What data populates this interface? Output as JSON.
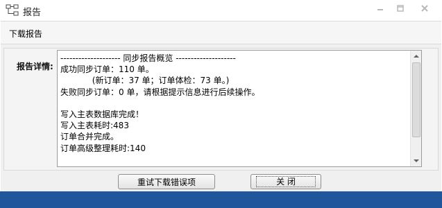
{
  "window": {
    "title": "报告",
    "icon": "report-tree-icon"
  },
  "header": {
    "title": "下载报告"
  },
  "details": {
    "label": "报告详情:",
    "lines": [
      "-------------------- 同步报告概览 --------------------",
      "成功同步订单：110 单。",
      "            (新订单：37 单；订单体检：73 单。)",
      "失败同步订单：0 单，请根据提示信息进行后续操作。",
      "",
      "写入主表数据库完成！",
      "写入主表耗时:483",
      "订单合并完成。",
      "订单高级整理耗时:140"
    ]
  },
  "buttons": {
    "retry": "重试下载错误项",
    "close": "关 闭"
  },
  "colors": {
    "statusbar": "#20569b",
    "background": "#f0f0f0"
  }
}
